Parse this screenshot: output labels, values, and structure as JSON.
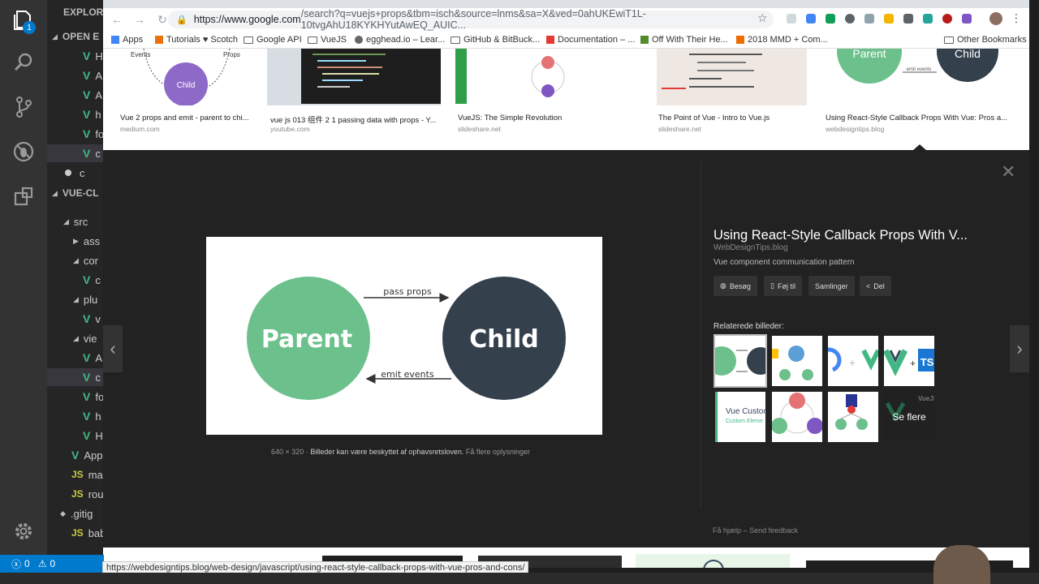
{
  "vscode": {
    "explorer_title": "EXPLOR",
    "open_editors": "OPEN E",
    "project": "VUE-CL",
    "tree": [
      {
        "kind": "vue",
        "label": "H"
      },
      {
        "kind": "vue",
        "label": "A"
      },
      {
        "kind": "vue",
        "label": "A"
      },
      {
        "kind": "vue",
        "label": "h"
      },
      {
        "kind": "vue",
        "label": "fo"
      },
      {
        "kind": "vue",
        "label": "c"
      },
      {
        "kind": "dot",
        "label": "c"
      }
    ],
    "project_tree": [
      {
        "kind": "folder-open",
        "label": "src"
      },
      {
        "kind": "folder",
        "label": "ass"
      },
      {
        "kind": "folder-open",
        "label": "cor"
      },
      {
        "kind": "vue",
        "label": "c"
      },
      {
        "kind": "folder-open",
        "label": "plu"
      },
      {
        "kind": "vue",
        "label": "v"
      },
      {
        "kind": "folder-open",
        "label": "vie"
      },
      {
        "kind": "vue",
        "label": "A"
      },
      {
        "kind": "vue",
        "label": "c"
      },
      {
        "kind": "vue",
        "label": "fo"
      },
      {
        "kind": "vue",
        "label": "h"
      },
      {
        "kind": "vue",
        "label": "H"
      },
      {
        "kind": "vue",
        "label": "App"
      },
      {
        "kind": "js",
        "label": "ma"
      },
      {
        "kind": "js",
        "label": "rou"
      },
      {
        "kind": "git",
        "label": ".gitig"
      },
      {
        "kind": "js",
        "label": "babe"
      }
    ],
    "badge": "1",
    "status_errors": "0",
    "status_warnings": "0"
  },
  "browser": {
    "url_host": "https://www.google.com",
    "url_rest": "/search?q=vuejs+props&tbm=isch&source=lnms&sa=X&ved=0ahUKEwiT1L-10tvgAhU18KYKHYutAwEQ_AUIC...",
    "bookmarks": [
      "Apps",
      "Tutorials ♥ Scotch",
      "Google API",
      "VueJS",
      "egghead.io – Lear...",
      "GitHub & BitBuck...",
      "Documentation – ...",
      "Off With Their He...",
      "2018 MMD + Com..."
    ],
    "other_bookmarks": "Other Bookmarks",
    "hover_url": "https://webdesigntips.blog/web-design/javascript/using-react-style-callback-props-with-vue-pros-and-cons/"
  },
  "results": [
    {
      "title": "Vue 2 props and emit - parent to chi...",
      "source": "medium.com"
    },
    {
      "title": "vue js 013 组件 2 1 passing data with props - Y...",
      "source": "youtube.com"
    },
    {
      "title": "VueJS: The Simple Revolution",
      "source": "slideshare.net"
    },
    {
      "title": "The Point of Vue - Intro to Vue.js",
      "source": "slideshare.net"
    },
    {
      "title": "Using React-Style Callback Props With Vue: Pros a...",
      "source": "webdesigntips.blog"
    }
  ],
  "thumb1": {
    "events": "Events",
    "props": "Props",
    "child": "Child"
  },
  "thumb5": {
    "parent": "Parent",
    "child": "Child",
    "emit": "emit events"
  },
  "preview": {
    "parent": "Parent",
    "child": "Child",
    "pass_props": "pass props",
    "emit_events": "emit events",
    "dimensions": "640 × 320",
    "copyright": "Billeder kan være beskyttet af ophavsretsloven.",
    "learn_more": "Få flere oplysninger",
    "title": "Using React-Style Callback Props With V...",
    "site": "WebDesignTips.blog",
    "description": "Vue component communication pattern",
    "buttons": {
      "visit": "Besøg",
      "save": "Føj til",
      "collections": "Samlinger",
      "share": "Del"
    },
    "related_label": "Relaterede billeder:",
    "see_more": "Se flere",
    "thumb_text": {
      "vue_custom": "Vue Custom",
      "custom_elem": "Custom Eleme",
      "ts": "TS",
      "plus": "+",
      "vuejs": "VueJS"
    },
    "help": "Få hjælp",
    "feedback": "Send feedback",
    "sep": "–"
  },
  "colors": {
    "vue_green": "#41b883",
    "vue_dark": "#35495e",
    "parent_green": "#6cc08b",
    "child_dark": "#34404c"
  }
}
